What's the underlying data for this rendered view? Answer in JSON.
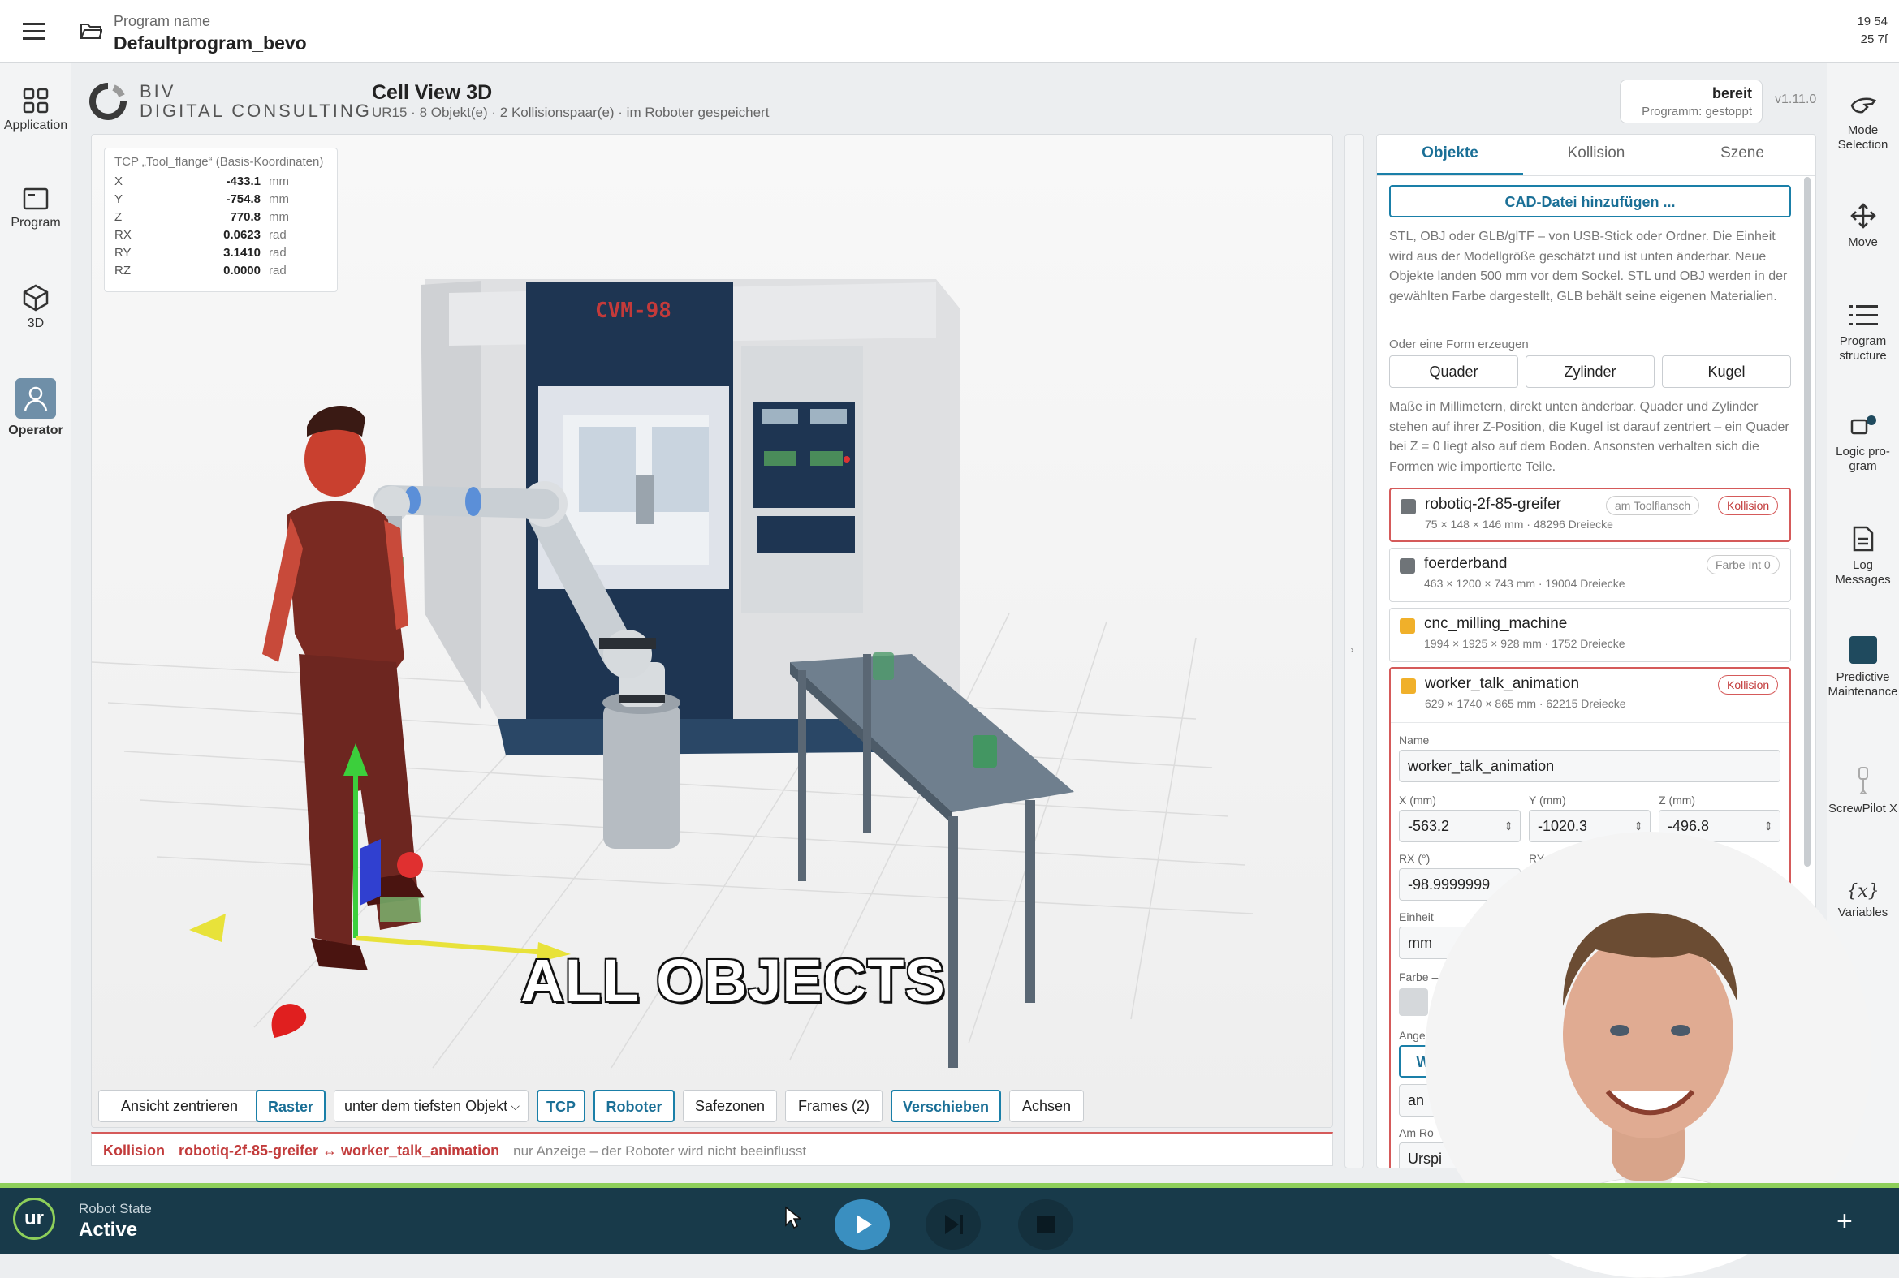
{
  "topbar": {
    "program_label": "Program name",
    "program_name": "Defaultprogram_bevo",
    "clock_line1": "19 54",
    "clock_line2": "25 7f"
  },
  "leftnav": [
    {
      "label": "Application",
      "icon": "grid-icon"
    },
    {
      "label": "Program",
      "icon": "program-icon"
    },
    {
      "label": "3D",
      "icon": "cube-icon"
    },
    {
      "label": "Operator",
      "icon": "person-icon"
    }
  ],
  "rightnav": [
    {
      "label": "Mode Selection",
      "icon": "hand-icon"
    },
    {
      "label": "Move",
      "icon": "move-icon"
    },
    {
      "label": "Program structure",
      "icon": "list-icon"
    },
    {
      "label": "Logic pro-gram",
      "icon": "logic-icon"
    },
    {
      "label": "Log Messages",
      "icon": "document-icon"
    },
    {
      "label": "Predictive Maintenance",
      "icon": "predictive-icon"
    },
    {
      "label": "ScrewPilot X",
      "icon": "screwdriver-icon"
    },
    {
      "label": "Variables",
      "icon": "variables-icon"
    }
  ],
  "header": {
    "logo_line1": "BIV",
    "logo_line2": "DIGITAL CONSULTING",
    "title": "Cell View 3D",
    "subtitle": "UR15 · 8 Objekt(e) · 2 Kollisionspaar(e) · im Roboter gespeichert",
    "status": "bereit",
    "status_sub": "Programm: gestoppt",
    "version": "v1.11.0"
  },
  "tcp": {
    "title": "TCP „Tool_flange“ (Basis-Koordinaten)",
    "rows": [
      {
        "axis": "X",
        "value": "-433.1",
        "unit": "mm"
      },
      {
        "axis": "Y",
        "value": "-754.8",
        "unit": "mm"
      },
      {
        "axis": "Z",
        "value": "770.8",
        "unit": "mm"
      },
      {
        "axis": "RX",
        "value": "0.0623",
        "unit": "rad"
      },
      {
        "axis": "RY",
        "value": "3.1410",
        "unit": "rad"
      },
      {
        "axis": "RZ",
        "value": "0.0000",
        "unit": "rad"
      }
    ]
  },
  "scene": {
    "machine_label": "CVM-98"
  },
  "toolbar": {
    "center_view": "Ansicht zentrieren",
    "grid": "Raster",
    "placement": "unter dem tiefsten Objekt",
    "tcp": "TCP",
    "robot": "Roboter",
    "safezones": "Safezonen",
    "frames": "Frames (2)",
    "move": "Verschieben",
    "axes": "Achsen"
  },
  "collision_bar": {
    "label": "Kollision",
    "pair": "robotiq-2f-85-greifer ↔ worker_talk_animation",
    "note": "nur Anzeige – der Roboter wird nicht beeinflusst"
  },
  "caption": "ALL OBJECTS",
  "panel": {
    "tabs": [
      "Objekte",
      "Kollision",
      "Szene"
    ],
    "add_cad": "CAD-Datei hinzufügen ...",
    "cad_help": "STL, OBJ oder GLB/glTF – von USB-Stick oder Ordner. Die Einheit wird aus der Modellgröße geschätzt und ist unten änderbar. Neue Objekte landen 500 mm vor dem Sockel. STL und OBJ werden in der gewählten Farbe dargestellt, GLB behält seine eigenen Materialien.",
    "shape_label": "Oder eine Form erzeugen",
    "shapes": [
      "Quader",
      "Zylinder",
      "Kugel"
    ],
    "shape_help": "Maße in Millimetern, direkt unten änderbar. Quader und Zylinder stehen auf ihrer Z-Position, die Kugel ist darauf zentriert – ein Quader bei Z = 0 liegt also auf dem Boden. Ansonsten verhalten sich die Formen wie importierte Teile.",
    "objects": [
      {
        "name": "robotiq-2f-85-greifer",
        "sub": "75 × 148 × 146 mm · 48296 Dreiecke",
        "tag1": "am Toolflansch",
        "tag2": "Kollision",
        "color": "#6f7478"
      },
      {
        "name": "foerderband",
        "sub": "463 × 1200 × 743 mm · 19004 Dreiecke",
        "tag1": "Farbe Int 0",
        "color": "#6f7478"
      },
      {
        "name": "cnc_milling_machine",
        "sub": "1994 × 1925 × 928 mm · 1752 Dreiecke",
        "color": "#f0b02a"
      },
      {
        "name": "worker_talk_animation",
        "sub": "629 × 1740 × 865 mm · 62215 Dreiecke",
        "tag2": "Kollision",
        "color": "#f0b02a"
      }
    ],
    "editor": {
      "name_label": "Name",
      "name_value": "worker_talk_animation",
      "x_label": "X (mm)",
      "x_value": "-563.2",
      "y_label": "Y (mm)",
      "y_value": "-1020.3",
      "z_label": "Z (mm)",
      "z_value": "-496.8",
      "rx_label": "RX (°)",
      "rx_value": "-98.9999999",
      "ry_label": "RY (°",
      "unit_label": "Einheit",
      "unit_value": "mm",
      "color_label": "Farbe –",
      "anchor_label": "Ange",
      "anchor_btn": "W",
      "anchor_value": "an",
      "origin_label": "Am Ro",
      "origin_value": "Urspi"
    }
  },
  "bottombar": {
    "state_label": "Robot State",
    "state_value": "Active",
    "logo": "ur"
  }
}
